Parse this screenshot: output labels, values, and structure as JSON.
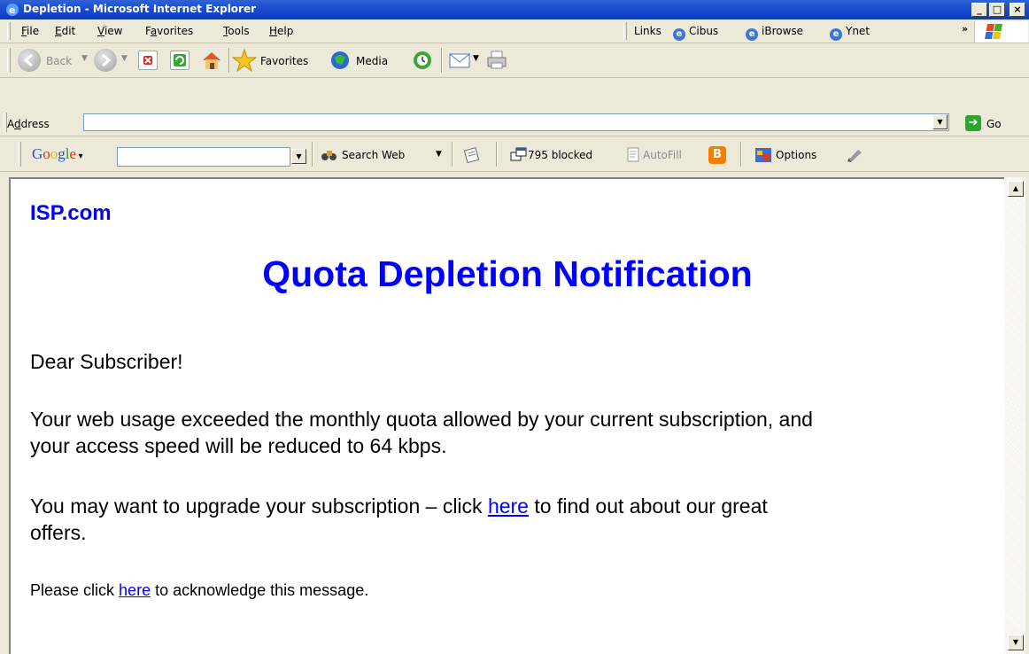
{
  "window": {
    "title": "Depletion - Microsoft Internet Explorer"
  },
  "menu": {
    "items": [
      "File",
      "Edit",
      "View",
      "Favorites",
      "Tools",
      "Help"
    ]
  },
  "links_bar": {
    "label": "Links",
    "items": [
      "Cibus",
      "iBrowse",
      "Ynet"
    ]
  },
  "toolbar": {
    "back": "Back",
    "favorites": "Favorites",
    "media": "Media"
  },
  "address": {
    "label": "Address",
    "value": "",
    "go": "Go"
  },
  "google_bar": {
    "logo": "Google",
    "search_value": "",
    "search_web": "Search Web",
    "blocked": "795 blocked",
    "autofill": "AutoFill",
    "options": "Options"
  },
  "page": {
    "brand": "ISP.com",
    "heading": "Quota Depletion Notification",
    "greeting": "Dear Subscriber!",
    "usage_line1": "Your web usage exceeded the monthly quota allowed by your current subscription, and",
    "usage_line2": "your access speed will be reduced to 64 kbps.",
    "upgrade_before": "You may want to upgrade your subscription – click ",
    "upgrade_link": "here",
    "upgrade_after": " to find out about our great",
    "upgrade_line2": "offers.",
    "ack_before": "Please click ",
    "ack_link": "here",
    "ack_after": " to acknowledge this message."
  }
}
